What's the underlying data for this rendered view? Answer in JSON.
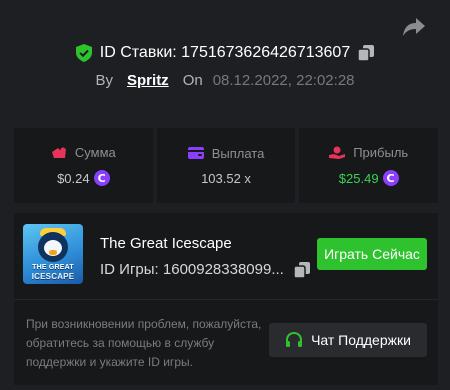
{
  "header": {
    "bet_id_label": "ID Ставки: 1751673626426713607",
    "by_label": "By",
    "username": "Spritz",
    "on_label": "On",
    "date": "08.12.2022, 22:02:28"
  },
  "stats": {
    "amount": {
      "label": "Сумма",
      "value": "$0.24",
      "icon": "coins-icon",
      "color": "#e8345a"
    },
    "payout": {
      "label": "Выплата",
      "value": "103.52 x",
      "icon": "wallet-icon",
      "color": "#8a3ffc"
    },
    "profit": {
      "label": "Прибыль",
      "value": "$25.49",
      "icon": "hand-coin-icon",
      "color": "#e8345a",
      "value_color": "#39d353"
    }
  },
  "coin_symbol": "C",
  "game": {
    "title": "The Great Icescape",
    "id_label": "ID Игры: 1600928338099...",
    "play_label": "Играть Сейчас",
    "thumb_line1": "THE GREAT",
    "thumb_line2": "ICESCAPE"
  },
  "support": {
    "help_text": "При возникновении проблем, пожалуйста, обратитесь за помощью в службу поддержки и укажите ID игры.",
    "button_label": "Чат Поддержки"
  },
  "colors": {
    "background": "#1e1f22",
    "panel": "#17181a",
    "accent_green": "#2fc22f",
    "accent_purple": "#8a3ffc"
  }
}
